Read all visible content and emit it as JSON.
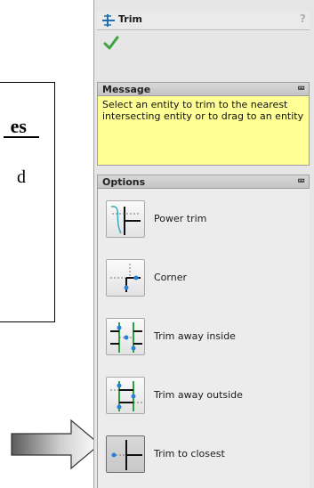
{
  "document": {
    "heading_fragment": "es",
    "text_fragment": "d"
  },
  "property_manager": {
    "title": "Trim",
    "help_glyph": "?",
    "message_group": {
      "title": "Message",
      "text": "Select an entity to trim to the nearest intersecting entity or to drag to an entity"
    },
    "options_group": {
      "title": "Options",
      "items": [
        {
          "label": "Power trim",
          "icon": "power-trim-icon"
        },
        {
          "label": "Corner",
          "icon": "corner-trim-icon"
        },
        {
          "label": "Trim away inside",
          "icon": "trim-away-inside-icon"
        },
        {
          "label": "Trim away outside",
          "icon": "trim-away-outside-icon"
        },
        {
          "label": "Trim to closest",
          "icon": "trim-to-closest-icon",
          "selected": true
        }
      ]
    }
  },
  "colors": {
    "message_background": "#ffff95",
    "ok_check": "#3fa33f",
    "entity_blue": "#2b7fd6",
    "entity_green": "#2ea043"
  }
}
